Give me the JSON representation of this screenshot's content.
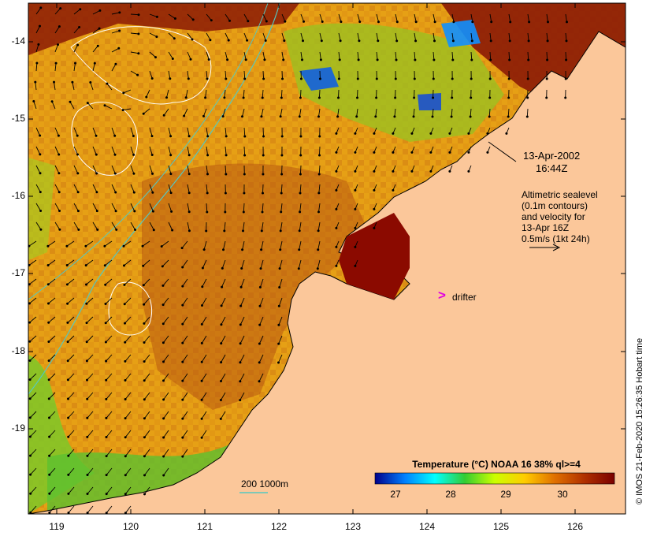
{
  "map": {
    "lat_labels": [
      "-14",
      "-15",
      "-16",
      "-17",
      "-18",
      "-19"
    ],
    "lon_labels": [
      "119",
      "120",
      "121",
      "122",
      "123",
      "124",
      "125",
      "126"
    ],
    "annotation": {
      "date": "13-Apr-2002",
      "time": "16:44Z"
    },
    "sealevel_note": {
      "line1": "Altimetric sealevel",
      "line2": "(0.1m contours)",
      "line3": "and velocity for",
      "line4": "13-Apr 16Z",
      "line5": "0.5m/s (1kt 24h)"
    },
    "drifter_label": "drifter",
    "drifter_symbol": ">",
    "isobath_label": "200  1000m",
    "credit": "© IMOS 21-Feb-2020 15:26:35 Hobart time",
    "colorbar": {
      "title": "Temperature (°C) NOAA 16 38% ql>=4",
      "ticks": [
        "27",
        "28",
        "29",
        "30"
      ],
      "colors": [
        "#00008b",
        "#0080ff",
        "#00ffff",
        "#33cc33",
        "#ccff00",
        "#ffcc00",
        "#e07000",
        "#b03000",
        "#7a0000"
      ]
    },
    "colors": {
      "land": "#fbc79a",
      "ocean_warm": "#e8a010",
      "arrow": "#000000",
      "contour": "#ffffff",
      "isobath": "#55c8c0",
      "drifter": "#e000e0"
    }
  }
}
